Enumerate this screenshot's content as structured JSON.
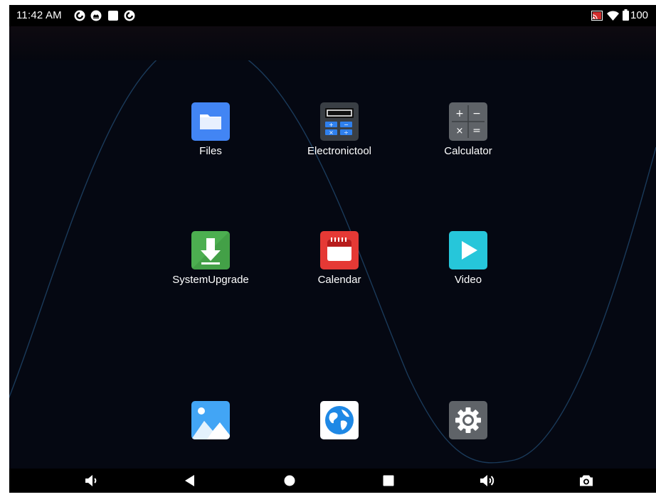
{
  "status_bar": {
    "time": "11:42 AM",
    "notification_icons": [
      "sync-icon",
      "android-robot-icon",
      "square-notification-icon",
      "sync-icon"
    ],
    "system_icons": [
      "cast-icon",
      "wifi-icon",
      "battery-icon"
    ],
    "battery_text": "100"
  },
  "apps": [
    {
      "label": "Files",
      "icon": "folder-icon",
      "color": "#4285f4"
    },
    {
      "label": "Electronictool",
      "icon": "electronic-tool-icon",
      "color": "#3a3f45"
    },
    {
      "label": "Calculator",
      "icon": "calculator-icon",
      "color": "#5f6368"
    },
    {
      "label": "SystemUpgrade",
      "icon": "download-arrow-icon",
      "color": "#4caf50"
    },
    {
      "label": "Calendar",
      "icon": "calendar-icon",
      "color": "#e53935"
    },
    {
      "label": "Video",
      "icon": "play-icon",
      "color": "#26c6da"
    },
    {
      "label": "",
      "icon": "gallery-icon",
      "color": "#42a5f5"
    },
    {
      "label": "",
      "icon": "globe-icon",
      "color": "#ffffff"
    },
    {
      "label": "",
      "icon": "settings-gear-icon",
      "color": "#5f6368"
    }
  ],
  "nav_bar": {
    "buttons": [
      "volume-down-icon",
      "back-icon",
      "home-icon",
      "recents-icon",
      "volume-up-icon",
      "camera-icon"
    ]
  },
  "colors": {
    "wallpaper": "#050812",
    "wave": "#1a3a5a"
  }
}
